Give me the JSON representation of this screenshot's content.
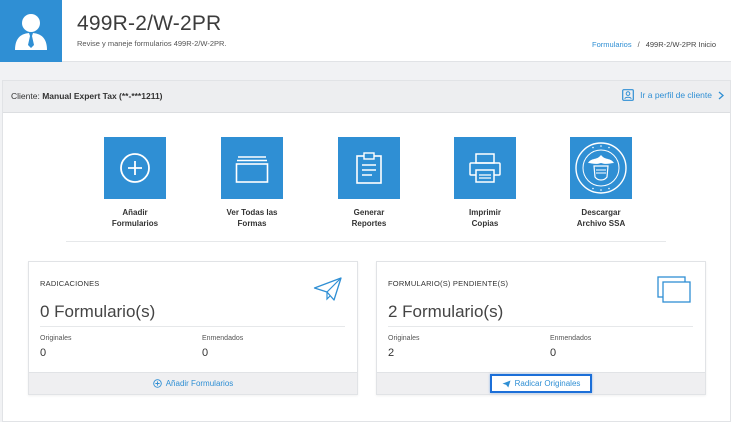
{
  "header": {
    "title": "499R-2/W-2PR",
    "subtitle": "Revise y maneje formularios 499R-2/W-2PR.",
    "breadcrumb": {
      "link": "Formularios",
      "separator": "/",
      "current": "499R-2/W-2PR Inicio"
    },
    "avatar_icon": "user-tie-icon"
  },
  "client_bar": {
    "label": "Cliente:",
    "name": "Manual Expert Tax (**-***1211)",
    "profile_link": "Ir a perfil de cliente"
  },
  "actions": [
    {
      "name": "add-forms",
      "icon": "plus-circle-icon",
      "line1": "Añadir",
      "line2": "Formularios"
    },
    {
      "name": "view-all-forms",
      "icon": "folder-icon",
      "line1": "Ver Todas las",
      "line2": "Formas"
    },
    {
      "name": "generate-reports",
      "icon": "clipboard-icon",
      "line1": "Generar",
      "line2": "Reportes"
    },
    {
      "name": "print-copies",
      "icon": "printer-icon",
      "line1": "Imprimir",
      "line2": "Copias"
    },
    {
      "name": "download-ssa",
      "icon": "ssa-seal-icon",
      "line1": "Descargar",
      "line2": "Archivo SSA"
    }
  ],
  "cards": {
    "filings": {
      "title": "RADICACIONES",
      "count": "0 Formulario(s)",
      "originals_label": "Originales",
      "originals_value": "0",
      "amended_label": "Enmendados",
      "amended_value": "0",
      "footer_link": "Añadir Formularios"
    },
    "pending": {
      "title": "FORMULARIO(S) PENDIENTE(S)",
      "count": "2 Formulario(s)",
      "originals_label": "Originales",
      "originals_value": "2",
      "amended_label": "Enmendados",
      "amended_value": "0",
      "footer_button": "Radicar Originales"
    }
  },
  "colors": {
    "accent": "#2f8fd4",
    "highlight_border": "#1c6fd8"
  }
}
